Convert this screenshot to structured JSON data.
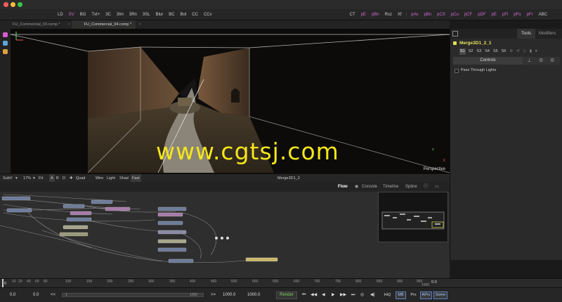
{
  "toolbar": {
    "items": [
      "LD",
      "SV",
      "BG",
      "Txt+",
      "3C",
      "3Im",
      "3Rn",
      "3SL",
      "Blur",
      "BC",
      "Bol",
      "CC",
      "CCv"
    ],
    "items_right": [
      "CT",
      "pE",
      "pBn",
      "Rsz",
      "Xf"
    ],
    "items_magenta": [
      "pAv",
      "pBn",
      "pCS",
      "pCu",
      "pCF",
      "pDF",
      "pE",
      "pFl",
      "pFo",
      "pFr"
    ],
    "items_end": [
      "ABC"
    ]
  },
  "tabs": [
    {
      "label": "FU_Commercial_03.comp *",
      "active": false
    },
    {
      "label": "FU_Commercial_04.comp *",
      "active": true
    }
  ],
  "viewer": {
    "watermark": "www.cgtsj.com",
    "camera_label": "Perspective",
    "gizmo_axis_y": "Y",
    "gizmo_axis_x": "X"
  },
  "viewer_bar": {
    "subview": "SubV",
    "subview_arrow": "▾",
    "zoom": "17%",
    "zoom_arrow": "▾",
    "fit": "Fit",
    "badges": [
      "A",
      "B",
      "D"
    ],
    "quad": "Quad",
    "options": [
      "Wire",
      "Light",
      "Shad",
      "Fast"
    ],
    "title": "Merge3D1_2"
  },
  "inspector": {
    "tabs": [
      "Tools",
      "Modifiers"
    ],
    "node_name": "Merge3D1_2_1",
    "slots": [
      "S1",
      "S2",
      "S3",
      "S4",
      "S5",
      "S6"
    ],
    "active_slot": "S1",
    "controls_label": "Controls",
    "checkbox_label": "Pass Through Lights",
    "checkbox_checked": false
  },
  "flow_panel": {
    "tabs": [
      "Flow",
      "Console",
      "Timeline",
      "Spline"
    ]
  },
  "ruler": {
    "start_value": "0",
    "end_value": "0.0",
    "ticks": [
      "10",
      "20",
      "40",
      "60",
      "80",
      "100",
      "150",
      "200",
      "250",
      "300",
      "350",
      "400",
      "450",
      "500",
      "550",
      "600",
      "650",
      "700",
      "750",
      "800",
      "850",
      "900",
      "950",
      "1000"
    ]
  },
  "transport": {
    "global_start": "0.0",
    "render_start": "0.0",
    "scrub_left": "<<",
    "scrub_mid": "1",
    "scrub_end": "1000",
    "scrub_right": ">>",
    "render_end": "1000.0",
    "global_end": "1000.0",
    "render_label": "Render",
    "hiq": "HiQ",
    "mb": "MB",
    "prx": "Prx",
    "aprx": "APrx",
    "some": "Some"
  },
  "colors": {
    "accent_yellow": "#e6e25a",
    "toolbar_magenta": "#d36ad6",
    "render_green": "#7fd35e",
    "watermark": "#f5e61a"
  }
}
